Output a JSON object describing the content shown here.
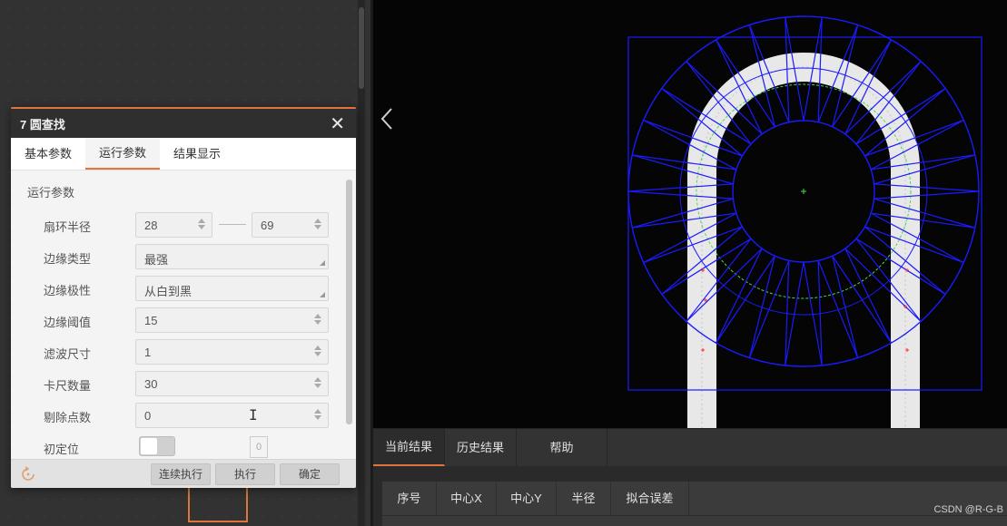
{
  "dialog": {
    "title": "7 圆查找",
    "close_glyph": "✕",
    "tabs": [
      "基本参数",
      "运行参数",
      "结果显示"
    ],
    "active_tab": "运行参数",
    "section_title": "运行参数",
    "params": {
      "sector_radius": {
        "label": "扇环半径",
        "min_value": "28",
        "max_value": "69"
      },
      "edge_type": {
        "label": "边缘类型",
        "value": "最强"
      },
      "edge_polarity": {
        "label": "边缘极性",
        "value": "从白到黑"
      },
      "edge_threshold": {
        "label": "边缘阈值",
        "value": "15"
      },
      "filter_size": {
        "label": "滤波尺寸",
        "value": "1"
      },
      "caliper_count": {
        "label": "卡尺数量",
        "value": "30"
      },
      "reject_count": {
        "label": "剔除点数",
        "value": "0"
      },
      "initial_position": {
        "label": "初定位",
        "value": "0",
        "enabled": false
      }
    },
    "footer": {
      "continuous_run": "连续执行",
      "run": "执行",
      "confirm": "确定"
    }
  },
  "results": {
    "tabs": [
      "当前结果",
      "历史结果",
      "帮助"
    ],
    "active_tab": "当前结果",
    "columns": [
      "序号",
      "中心X",
      "中心Y",
      "半径",
      "拟合误差"
    ]
  },
  "watermark": "CSDN @R-G-B",
  "colors": {
    "accent": "#e0743a",
    "overlay_blue": "#1a1aff",
    "fit_green": "#4cd94c",
    "outlier_red": "#ff3030"
  },
  "icons": {
    "close": "close-icon",
    "reset": "reset-icon",
    "prev": "chevron-left-icon"
  }
}
